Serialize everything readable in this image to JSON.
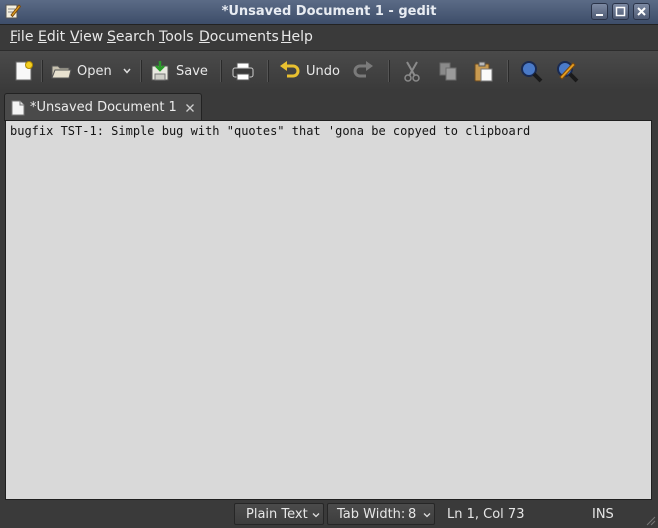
{
  "window": {
    "title": "*Unsaved Document 1 - gedit"
  },
  "menu": {
    "items": [
      {
        "label": "File",
        "u": "F",
        "rest": "ile"
      },
      {
        "label": "Edit",
        "u": "E",
        "rest": "dit"
      },
      {
        "label": "View",
        "u": "V",
        "rest": "iew"
      },
      {
        "label": "Search",
        "u": "S",
        "rest": "earch"
      },
      {
        "label": "Tools",
        "u": "T",
        "rest": "ools"
      },
      {
        "label": "Documents",
        "u": "D",
        "rest": "ocuments"
      },
      {
        "label": "Help",
        "u": "H",
        "rest": "elp"
      }
    ]
  },
  "toolbar": {
    "open_label": "Open",
    "save_label": "Save",
    "undo_label": "Undo"
  },
  "tab": {
    "label": "*Unsaved Document 1"
  },
  "editor": {
    "text": "bugfix TST-1: Simple bug with \"quotes\" that 'gona be copyed to clipboard"
  },
  "status": {
    "language": "Plain Text",
    "tab_width_label": "Tab Width:",
    "tab_width_value": "8",
    "position": "Ln 1, Col 73",
    "mode": "INS"
  },
  "colors": {
    "editor_bg": "#d9d9d9",
    "chrome_bg": "#3a3a3a",
    "titlebar": "#4b5b78"
  }
}
